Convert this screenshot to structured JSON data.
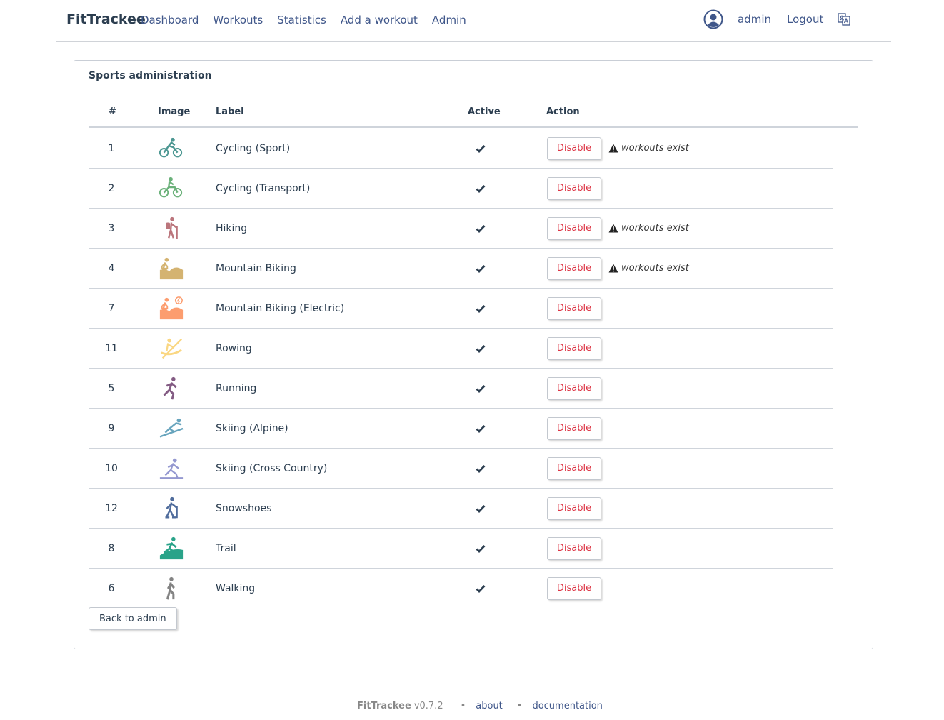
{
  "navbar": {
    "brand": "FitTrackee",
    "links": [
      "Dashboard",
      "Workouts",
      "Statistics",
      "Add a workout",
      "Admin"
    ],
    "user": "admin",
    "logout": "Logout"
  },
  "card": {
    "title": "Sports administration",
    "columns": {
      "id": "#",
      "image": "Image",
      "label": "Label",
      "active": "Active",
      "action": "Action"
    },
    "rows": [
      {
        "id": "1",
        "label": "Cycling (Sport)",
        "icon": "cycling-sport-icon",
        "color": "#4c9792",
        "button": "Disable",
        "warning": "workouts exist"
      },
      {
        "id": "2",
        "label": "Cycling (Transport)",
        "icon": "cycling-transport-icon",
        "color": "#6bb17a",
        "button": "Disable",
        "warning": ""
      },
      {
        "id": "3",
        "label": "Hiking",
        "icon": "hiking-icon",
        "color": "#bb757c",
        "button": "Disable",
        "warning": "workouts exist"
      },
      {
        "id": "4",
        "label": "Mountain Biking",
        "icon": "mountain-biking-icon",
        "color": "#d4b371",
        "button": "Disable",
        "warning": "workouts exist"
      },
      {
        "id": "7",
        "label": "Mountain Biking (Electric)",
        "icon": "mountain-biking-electric-icon",
        "color": "#fc9d6f",
        "button": "Disable",
        "warning": ""
      },
      {
        "id": "11",
        "label": "Rowing",
        "icon": "rowing-icon",
        "color": "#fad783",
        "button": "Disable",
        "warning": ""
      },
      {
        "id": "5",
        "label": "Running",
        "icon": "running-icon",
        "color": "#835b83",
        "button": "Disable",
        "warning": ""
      },
      {
        "id": "9",
        "label": "Skiing (Alpine)",
        "icon": "skiing-alpine-icon",
        "color": "#67a4bd",
        "button": "Disable",
        "warning": ""
      },
      {
        "id": "10",
        "label": "Skiing (Cross Country)",
        "icon": "skiing-cross-country-icon",
        "color": "#9498d0",
        "button": "Disable",
        "warning": ""
      },
      {
        "id": "12",
        "label": "Snowshoes",
        "icon": "snowshoes-icon",
        "color": "#4f6c9c",
        "button": "Disable",
        "warning": ""
      },
      {
        "id": "8",
        "label": "Trail",
        "icon": "trail-icon",
        "color": "#29a389",
        "button": "Disable",
        "warning": ""
      },
      {
        "id": "6",
        "label": "Walking",
        "icon": "walking-icon",
        "color": "#838383",
        "button": "Disable",
        "warning": ""
      }
    ],
    "back_button": "Back to admin"
  },
  "footer": {
    "name": "FitTrackee",
    "version": "v0.7.2",
    "separator": "•",
    "about": "about",
    "documentation": "documentation"
  },
  "colors": {
    "link": "#40578a",
    "danger": "#dc3545",
    "border": "#c9ced6"
  }
}
